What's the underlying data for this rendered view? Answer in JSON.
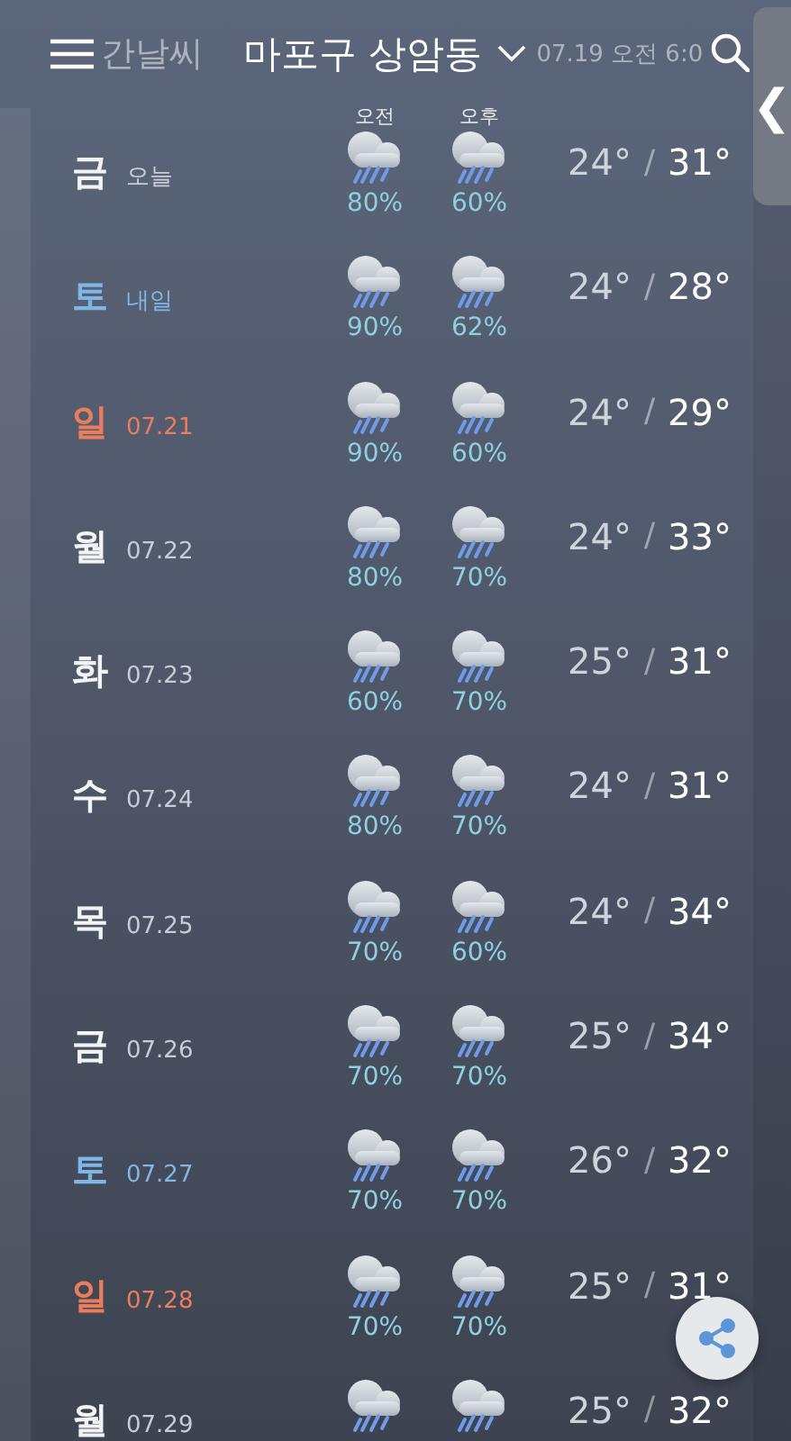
{
  "header": {
    "menu_hidden_title": "간날씨",
    "location": "마포구 상암동",
    "updated": "07.19 오전 6:0"
  },
  "columns": {
    "am": "오전",
    "pm": "오후"
  },
  "days": [
    {
      "day": "금",
      "date": "오늘",
      "kind": "weekday",
      "am_pop": "80%",
      "pm_pop": "60%",
      "low": "24°",
      "high": "31°"
    },
    {
      "day": "토",
      "date": "내일",
      "kind": "saturday",
      "am_pop": "90%",
      "pm_pop": "62%",
      "low": "24°",
      "high": "28°"
    },
    {
      "day": "일",
      "date": "07.21",
      "kind": "sunday",
      "am_pop": "90%",
      "pm_pop": "60%",
      "low": "24°",
      "high": "29°"
    },
    {
      "day": "월",
      "date": "07.22",
      "kind": "weekday",
      "am_pop": "80%",
      "pm_pop": "70%",
      "low": "24°",
      "high": "33°"
    },
    {
      "day": "화",
      "date": "07.23",
      "kind": "weekday",
      "am_pop": "60%",
      "pm_pop": "70%",
      "low": "25°",
      "high": "31°"
    },
    {
      "day": "수",
      "date": "07.24",
      "kind": "weekday",
      "am_pop": "80%",
      "pm_pop": "70%",
      "low": "24°",
      "high": "31°"
    },
    {
      "day": "목",
      "date": "07.25",
      "kind": "weekday",
      "am_pop": "70%",
      "pm_pop": "60%",
      "low": "24°",
      "high": "34°"
    },
    {
      "day": "금",
      "date": "07.26",
      "kind": "weekday",
      "am_pop": "70%",
      "pm_pop": "70%",
      "low": "25°",
      "high": "34°"
    },
    {
      "day": "토",
      "date": "07.27",
      "kind": "saturday",
      "am_pop": "70%",
      "pm_pop": "70%",
      "low": "26°",
      "high": "32°"
    },
    {
      "day": "일",
      "date": "07.28",
      "kind": "sunday",
      "am_pop": "70%",
      "pm_pop": "70%",
      "low": "25°",
      "high": "31°"
    },
    {
      "day": "월",
      "date": "07.29",
      "kind": "weekday",
      "low": "25°",
      "high": "32°"
    }
  ],
  "separator": "/",
  "side_tab": {
    "glyph": "❮"
  }
}
